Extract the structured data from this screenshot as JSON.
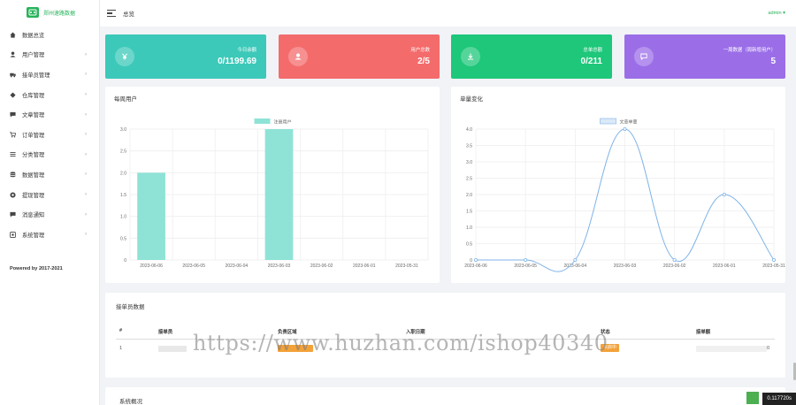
{
  "brand": {
    "name": "郑州速路数据"
  },
  "topbar": {
    "title": "总览",
    "user": "admin ▾"
  },
  "sidebar": {
    "items": [
      {
        "label": "数据总览",
        "icon": "home-icon",
        "chevron": ""
      },
      {
        "label": "用户管理",
        "icon": "user-icon",
        "chevron": "›"
      },
      {
        "label": "接单员管理",
        "icon": "truck-icon",
        "chevron": "›"
      },
      {
        "label": "仓库管理",
        "icon": "diamond-icon",
        "chevron": "›"
      },
      {
        "label": "文章管理",
        "icon": "comment-icon",
        "chevron": "›"
      },
      {
        "label": "订单管理",
        "icon": "cart-icon",
        "chevron": "›"
      },
      {
        "label": "分类管理",
        "icon": "list-icon",
        "chevron": "›"
      },
      {
        "label": "数据管理",
        "icon": "database-icon",
        "chevron": "›"
      },
      {
        "label": "提现管理",
        "icon": "coin-icon",
        "chevron": "›"
      },
      {
        "label": "消息通知",
        "icon": "message-icon",
        "chevron": "›"
      },
      {
        "label": "系统管理",
        "icon": "settings-icon",
        "chevron": "›"
      }
    ],
    "powered": "Powered by 2017-2021"
  },
  "stats": [
    {
      "label": "今日余额",
      "value": "0/1199.69",
      "color": "#3cc9b9",
      "icon": "yen-icon"
    },
    {
      "label": "用户总数",
      "value": "2/5",
      "color": "#f46b6b",
      "icon": "user-icon"
    },
    {
      "label": "总单总额",
      "value": "0/211",
      "color": "#1ec77a",
      "icon": "download-icon"
    },
    {
      "label": "一周数据（周新增用户）",
      "value": "5",
      "color": "#9b6ee8",
      "icon": "chat-icon"
    }
  ],
  "chart_data": [
    {
      "type": "bar",
      "title": "每周用户",
      "categories": [
        "2023-06-06",
        "2023-06-05",
        "2023-06-04",
        "2023-06-03",
        "2023-06-02",
        "2023-06-01",
        "2023-05-31"
      ],
      "series": [
        {
          "name": "注册用户",
          "values": [
            2,
            0,
            0,
            3,
            0,
            0,
            0
          ]
        }
      ],
      "ylim": [
        0,
        3
      ],
      "yticks": [
        "0",
        "0.5",
        "1.0",
        "1.5",
        "2.0",
        "2.5",
        "3.0"
      ],
      "color": "#8fe3d6",
      "legend": "top-center",
      "grid": true
    },
    {
      "type": "line",
      "title": "单量变化",
      "categories": [
        "2023-06-06",
        "2023-06-05",
        "2023-06-04",
        "2023-06-03",
        "2023-06-02",
        "2023-06-01",
        "2023-05-31"
      ],
      "series": [
        {
          "name": "文章单量",
          "values": [
            0,
            0,
            0,
            4,
            0,
            2,
            0
          ]
        }
      ],
      "ylim": [
        0,
        4
      ],
      "yticks": [
        "0",
        "0.5",
        "1.0",
        "1.5",
        "2.0",
        "2.5",
        "3.0",
        "3.5",
        "4.0"
      ],
      "color": "#7fb3e8",
      "legend": "top-center",
      "grid": true
    }
  ],
  "table": {
    "title": "接单员数据",
    "headers": [
      "#",
      "接单员",
      "负责区域",
      "入职日期",
      "状态",
      "接单额"
    ],
    "rows": [
      {
        "index": "1",
        "status": "未启中",
        "amount": "0"
      }
    ]
  },
  "watermark": "https://www.huzhan.com/ishop40340",
  "system": {
    "title": "系统概况"
  },
  "timer": "0.117720s"
}
